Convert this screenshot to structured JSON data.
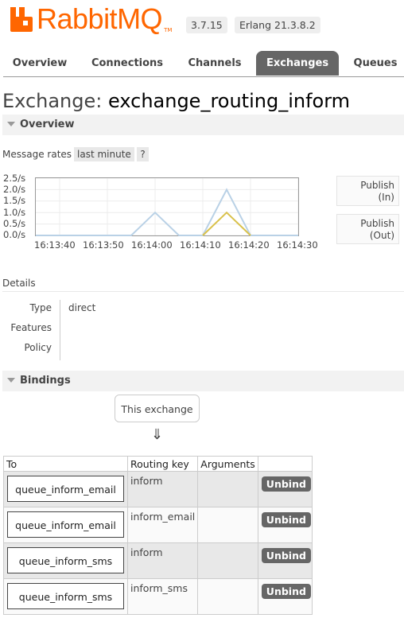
{
  "header": {
    "logo_text": "RabbitMQ",
    "logo_tm": "TM",
    "version": "3.7.15",
    "erlang": "Erlang 21.3.8.2",
    "brand_color": "#ff6600"
  },
  "tabs": [
    {
      "label": "Overview",
      "active": false
    },
    {
      "label": "Connections",
      "active": false
    },
    {
      "label": "Channels",
      "active": false
    },
    {
      "label": "Exchanges",
      "active": true
    },
    {
      "label": "Queues",
      "active": false
    }
  ],
  "page": {
    "title_prefix": "Exchange:",
    "exchange_name": "exchange_routing_inform"
  },
  "overview": {
    "section_label": "Overview",
    "message_rates_label": "Message rates",
    "message_rates_value": "last minute",
    "help_label": "?",
    "legend": [
      {
        "line1": "Publish",
        "line2": "(In)"
      },
      {
        "line1": "Publish",
        "line2": "(Out)"
      }
    ]
  },
  "chart_data": {
    "type": "line",
    "title": "",
    "xlabel": "",
    "ylabel": "",
    "y_ticks": [
      "2.5/s",
      "2.0/s",
      "1.5/s",
      "1.0/s",
      "0.5/s",
      "0.0/s"
    ],
    "x_ticks": [
      "16:13:40",
      "16:13:50",
      "16:14:00",
      "16:14:10",
      "16:14:20",
      "16:14:30"
    ],
    "ylim": [
      0,
      2.5
    ],
    "x_seconds_range": [
      0,
      55
    ],
    "series": [
      {
        "color": "#b9d1e6",
        "points": [
          [
            0,
            0
          ],
          [
            20,
            0
          ],
          [
            25,
            1.0
          ],
          [
            30,
            0
          ],
          [
            35,
            0
          ],
          [
            40,
            2.0
          ],
          [
            45,
            0
          ],
          [
            55,
            0
          ]
        ]
      },
      {
        "color": "#d9c14a",
        "points": [
          [
            35,
            0
          ],
          [
            40,
            1.0
          ],
          [
            45,
            0
          ]
        ]
      }
    ],
    "grid": true
  },
  "details": {
    "heading": "Details",
    "rows": [
      {
        "label": "Type",
        "value": "direct"
      },
      {
        "label": "Features",
        "value": ""
      },
      {
        "label": "Policy",
        "value": ""
      }
    ]
  },
  "bindings": {
    "section_label": "Bindings",
    "this_exchange": "This exchange",
    "arrow": "⇓",
    "columns": [
      "To",
      "Routing key",
      "Arguments",
      ""
    ],
    "unbind_label": "Unbind",
    "rows": [
      {
        "to": "queue_inform_email",
        "routing_key": "inform"
      },
      {
        "to": "queue_inform_email",
        "routing_key": "inform_email"
      },
      {
        "to": "queue_inform_sms",
        "routing_key": "inform"
      },
      {
        "to": "queue_inform_sms",
        "routing_key": "inform_sms"
      }
    ]
  }
}
